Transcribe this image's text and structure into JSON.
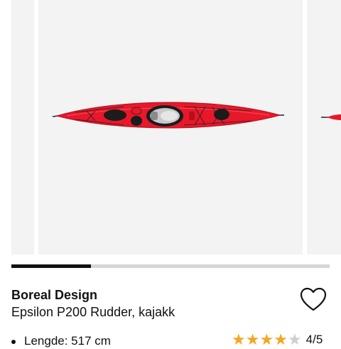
{
  "gallery": {
    "image_alt": "Red sea kayak, top view",
    "image_count": 4,
    "current_index": 1,
    "progress_fraction": 0.25,
    "colors": {
      "hull": "#e8172a",
      "hull_dark": "#b50f1e",
      "hatch": "#1c1c1c",
      "slide_bg": "#f3f3f3"
    }
  },
  "product": {
    "brand": "Boreal Design",
    "name": "Epsilon P200 Rudder, kajakk",
    "spec_text": "Lengde: 517 cm",
    "favorite_icon": "heart-outline-icon"
  },
  "rating": {
    "value": 4,
    "max": 5,
    "label": "4/5",
    "colors": {
      "filled": "#f5a623",
      "empty": "#cfcfcf"
    }
  }
}
